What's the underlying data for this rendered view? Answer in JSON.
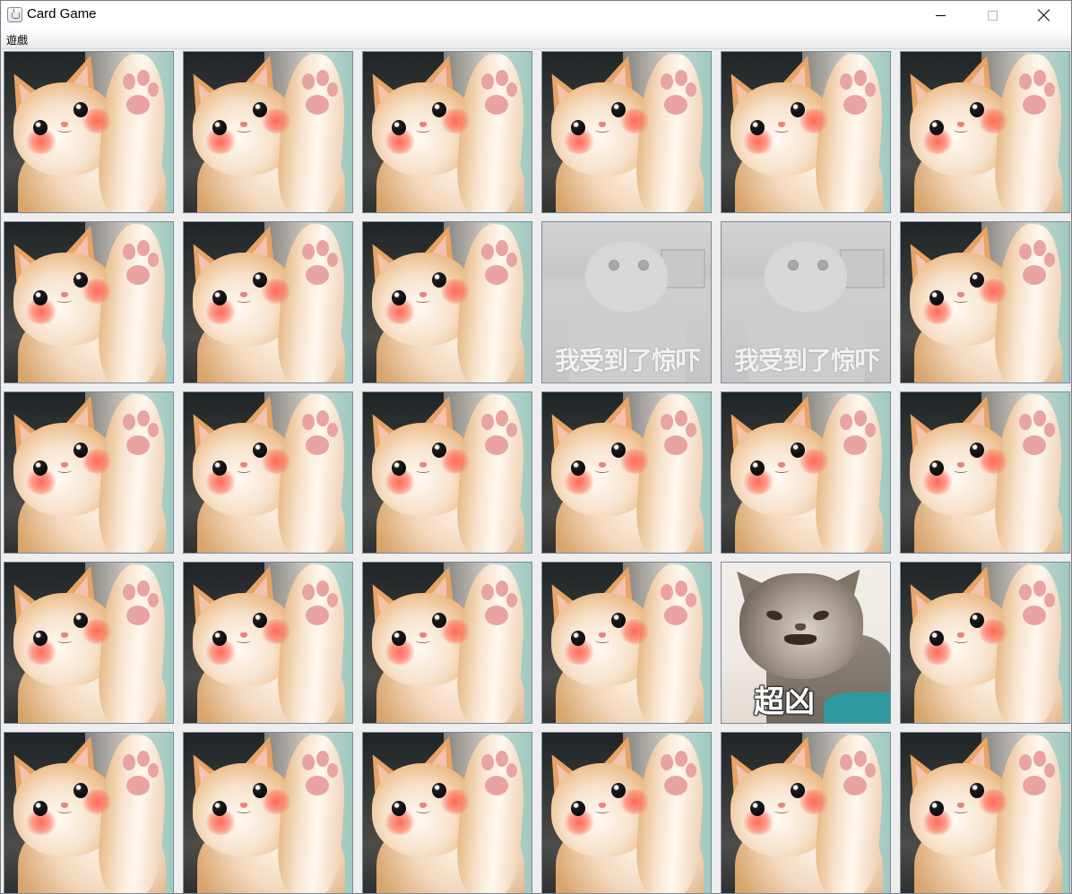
{
  "window": {
    "title": "Card Game",
    "controls": {
      "minimize_icon": "minimize-icon",
      "maximize_icon": "maximize-icon",
      "close_icon": "close-icon"
    }
  },
  "menubar": {
    "items": [
      {
        "label": "遊戲"
      }
    ]
  },
  "board": {
    "rows": 5,
    "columns": 6,
    "card_back": "orange-kitten-waving",
    "cards": [
      {
        "state": "back"
      },
      {
        "state": "back"
      },
      {
        "state": "back"
      },
      {
        "state": "back"
      },
      {
        "state": "back"
      },
      {
        "state": "back"
      },
      {
        "state": "back"
      },
      {
        "state": "back"
      },
      {
        "state": "back"
      },
      {
        "state": "matched",
        "face": "surprised-gray-cat",
        "caption": "我受到了惊吓"
      },
      {
        "state": "matched",
        "face": "surprised-gray-cat",
        "caption": "我受到了惊吓"
      },
      {
        "state": "back"
      },
      {
        "state": "back"
      },
      {
        "state": "back"
      },
      {
        "state": "back"
      },
      {
        "state": "back"
      },
      {
        "state": "back"
      },
      {
        "state": "back"
      },
      {
        "state": "back"
      },
      {
        "state": "back"
      },
      {
        "state": "back"
      },
      {
        "state": "back"
      },
      {
        "state": "revealed",
        "face": "angry-tabby-cat",
        "caption": "超凶"
      },
      {
        "state": "back"
      },
      {
        "state": "back"
      },
      {
        "state": "back"
      },
      {
        "state": "back"
      },
      {
        "state": "back"
      },
      {
        "state": "back"
      },
      {
        "state": "back"
      }
    ]
  }
}
